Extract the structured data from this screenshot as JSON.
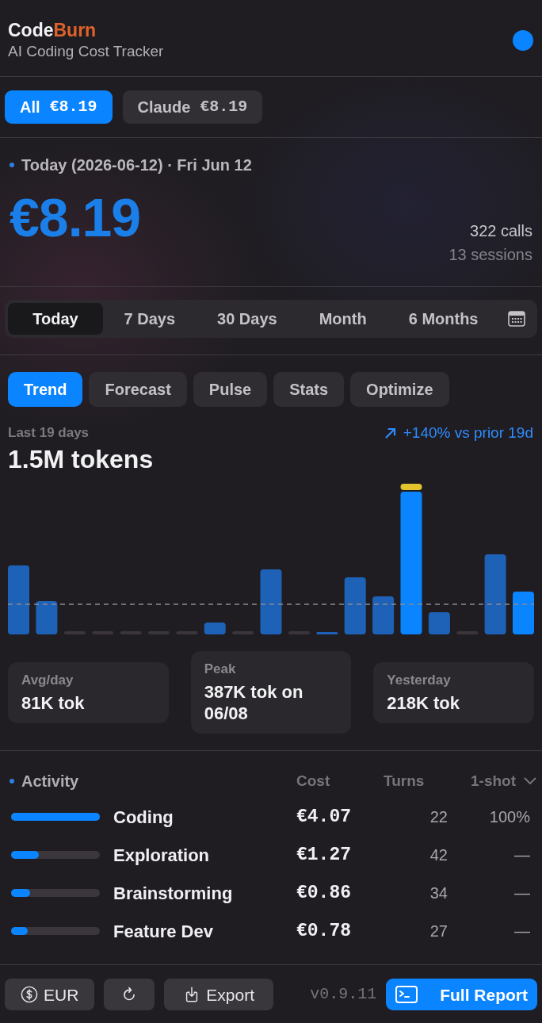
{
  "header": {
    "title_lead": "Code",
    "title_accent": "Burn",
    "subtitle": "AI Coding Cost Tracker"
  },
  "providers": [
    {
      "label": "All",
      "amount": "€8.19",
      "selected": true
    },
    {
      "label": "Claude",
      "amount": "€8.19",
      "selected": false
    }
  ],
  "summary": {
    "date_label": "Today (2026-06-12) · Fri Jun 12",
    "total": "€8.19",
    "calls": "322 calls",
    "sessions": "13 sessions"
  },
  "periods": [
    {
      "label": "Today",
      "selected": true
    },
    {
      "label": "7 Days",
      "selected": false
    },
    {
      "label": "30 Days",
      "selected": false
    },
    {
      "label": "Month",
      "selected": false
    },
    {
      "label": "6 Months",
      "selected": false
    }
  ],
  "view_tabs": [
    {
      "label": "Trend",
      "selected": true
    },
    {
      "label": "Forecast",
      "selected": false
    },
    {
      "label": "Pulse",
      "selected": false
    },
    {
      "label": "Stats",
      "selected": false
    },
    {
      "label": "Optimize",
      "selected": false
    }
  ],
  "trend": {
    "range_label": "Last 19 days",
    "change": "+140% vs prior 19d",
    "total": "1.5M tokens"
  },
  "stats": [
    {
      "label": "Avg/day",
      "value": "81K tok"
    },
    {
      "label": "Peak",
      "value": "387K tok on 06/08"
    },
    {
      "label": "Yesterday",
      "value": "218K tok"
    }
  ],
  "activity": {
    "title": "Activity",
    "columns": [
      "Cost",
      "Turns",
      "1-shot"
    ],
    "rows": [
      {
        "name": "Coding",
        "cost": "€4.07",
        "turns": "22",
        "one_shot": "100%",
        "level": 1.0
      },
      {
        "name": "Exploration",
        "cost": "€1.27",
        "turns": "42",
        "one_shot": "—",
        "level": 0.31
      },
      {
        "name": "Brainstorming",
        "cost": "€0.86",
        "turns": "34",
        "one_shot": "—",
        "level": 0.21
      },
      {
        "name": "Feature Dev",
        "cost": "€0.78",
        "turns": "27",
        "one_shot": "—",
        "level": 0.19
      }
    ]
  },
  "footer": {
    "currency": "EUR",
    "export": "Export",
    "version": "v0.9.11",
    "report": "Full Report"
  }
}
